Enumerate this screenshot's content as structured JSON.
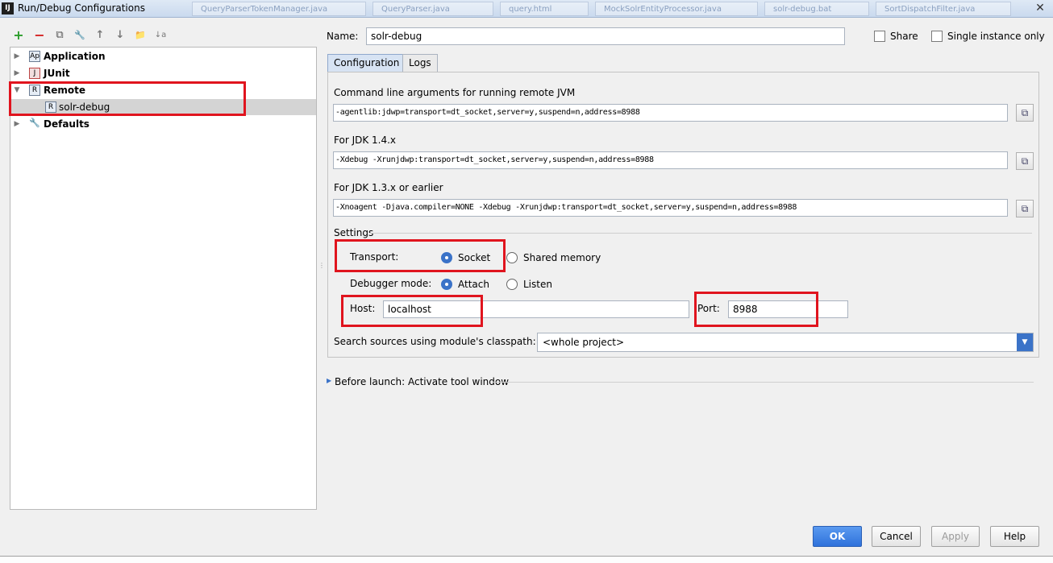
{
  "window": {
    "title": "Run/Debug Configurations",
    "app_icon": "IJ",
    "background_tabs": [
      "QueryParserTokenManager.java",
      "QueryParser.java",
      "query.html",
      "MockSolrEntityProcessor.java",
      "solr-debug.bat",
      "SortDispatchFilter.java"
    ]
  },
  "toolbar": {
    "add": "+",
    "remove": "−",
    "copy": "⧉",
    "edit_defaults": "🔧",
    "move_up": "↑",
    "move_down": "↓",
    "folder": "📁",
    "sort": "↓a"
  },
  "tree": {
    "items": [
      {
        "label": "Application",
        "arrow": "▶",
        "icon": "Ap"
      },
      {
        "label": "JUnit",
        "arrow": "▶",
        "icon": "J"
      },
      {
        "label": "Remote",
        "arrow": "▼",
        "icon": "R"
      },
      {
        "label": "solr-debug",
        "icon": "R"
      },
      {
        "label": "Defaults",
        "arrow": "▶",
        "icon": "🔧"
      }
    ]
  },
  "header": {
    "name_label": "Name:",
    "name_value": "solr-debug",
    "share_label": "Share",
    "single_instance_label": "Single instance only"
  },
  "tabs": {
    "configuration": "Configuration",
    "logs": "Logs"
  },
  "config": {
    "cmd_label": "Command line arguments for running remote JVM",
    "cmd_value": "-agentlib:jdwp=transport=dt_socket,server=y,suspend=n,address=8988",
    "jdk14_label": "For JDK 1.4.x",
    "jdk14_value": "-Xdebug -Xrunjdwp:transport=dt_socket,server=y,suspend=n,address=8988",
    "jdk13_label": "For JDK 1.3.x or earlier",
    "jdk13_value": "-Xnoagent -Djava.compiler=NONE -Xdebug -Xrunjdwp:transport=dt_socket,server=y,suspend=n,address=8988",
    "copy_icon": "⧉"
  },
  "settings": {
    "title": "Settings",
    "transport_label": "Transport:",
    "socket_label": "Socket",
    "shared_memory_label": "Shared memory",
    "debugger_mode_label": "Debugger mode:",
    "attach_label": "Attach",
    "listen_label": "Listen",
    "host_label": "Host:",
    "host_value": "localhost",
    "port_label": "Port:",
    "port_value": "8988",
    "classpath_label": "Search sources using module's classpath:",
    "classpath_value": "<whole project>",
    "classpath_arrow": "▼"
  },
  "before_launch": {
    "arrow": "▶",
    "label": "Before launch: Activate tool window"
  },
  "buttons": {
    "ok": "OK",
    "cancel": "Cancel",
    "apply": "Apply",
    "help": "Help"
  },
  "misc": {
    "close": "✕",
    "splitter": "⋮"
  },
  "colors": {
    "accent": "#3b73c8",
    "highlight_box": "#e0141e",
    "selection": "#d4d4d4"
  }
}
